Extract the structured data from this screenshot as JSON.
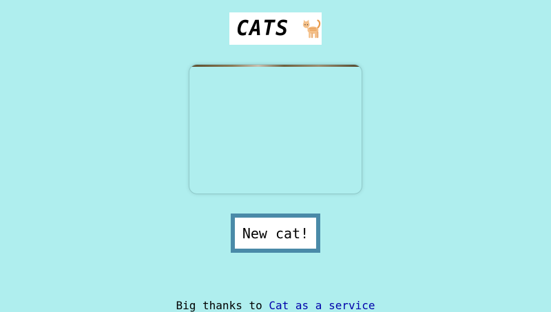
{
  "header": {
    "title": "CATS",
    "emoji_icon": "cat-icon"
  },
  "main": {
    "image_alt": "cat image",
    "button_label": "New cat!"
  },
  "footer": {
    "text": "Big thanks to",
    "link_text": "Cat as a service"
  },
  "colors": {
    "background": "#afeeee",
    "button_border": "#4a8aa8",
    "link": "#0000aa"
  }
}
